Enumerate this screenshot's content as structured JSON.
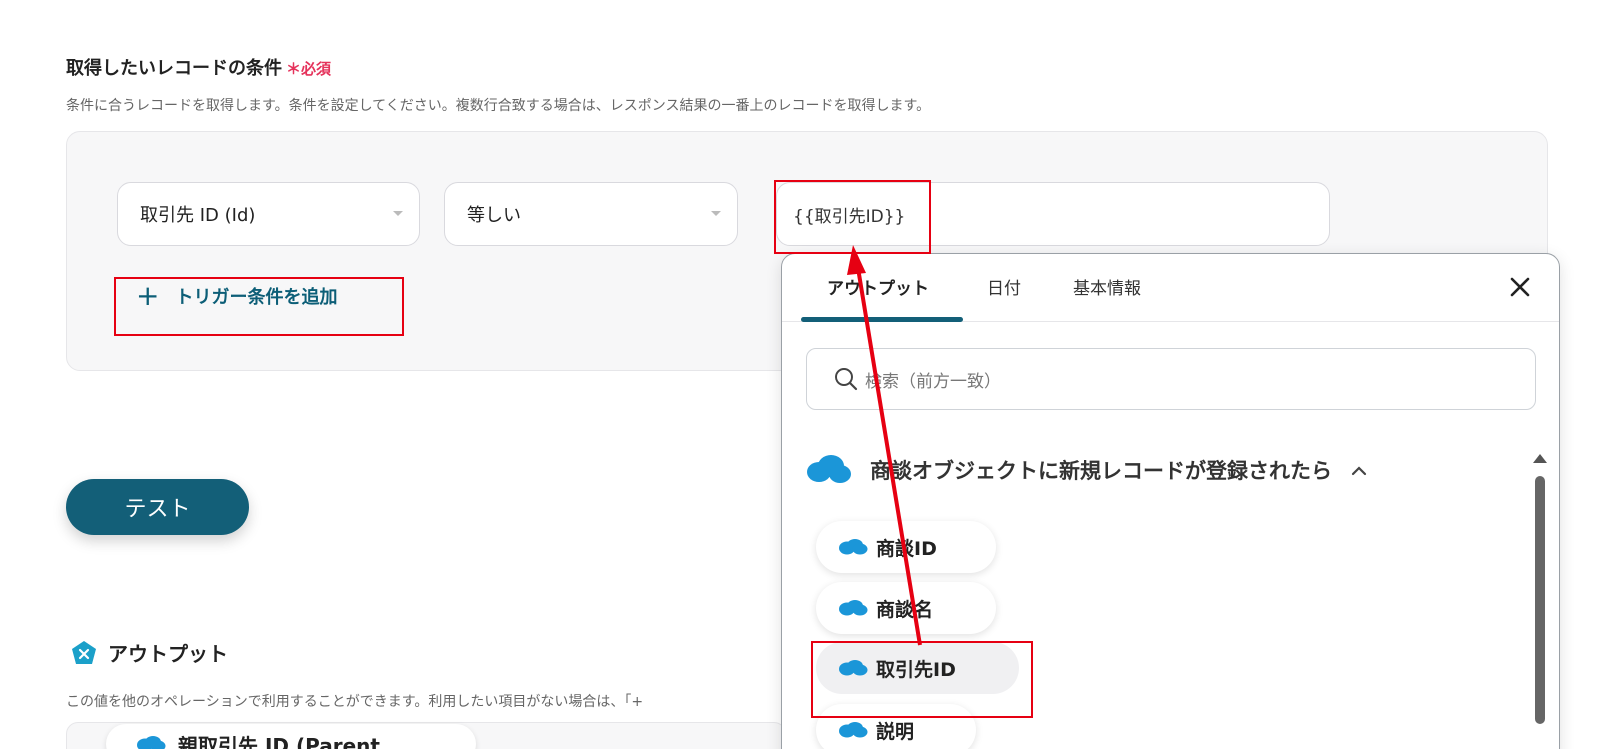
{
  "header": {
    "title": "取得したいレコードの条件",
    "required_mark": "＊必須",
    "description": "条件に合うレコードを取得します。条件を設定してください。複数行合致する場合は、レスポンス結果の一番上のレコードを取得します。"
  },
  "condition": {
    "field_select": "取引先 ID (Id)",
    "operator_select": "等しい",
    "value": "{{取引先ID}}",
    "add_trigger_label": "トリガー条件を追加"
  },
  "test_button": "テスト",
  "output": {
    "title": "アウトプット",
    "description": "この値を他のオペレーションで利用することができます。利用したい項目がない場合は、「+",
    "first_item": "親取引先 ID (Parent…"
  },
  "popup": {
    "tabs": [
      "アウトプット",
      "日付",
      "基本情報"
    ],
    "active_tab": 0,
    "search_placeholder": "検索（前方一致）",
    "group_title": "商談オブジェクトに新規レコードが登録されたら",
    "items": [
      "商談ID",
      "商談名",
      "取引先ID",
      "説明"
    ],
    "selected_item": "取引先ID"
  },
  "colors": {
    "accent": "#135f78",
    "required": "#e5325b",
    "highlight": "#e60012",
    "salesforce": "#1b96d8"
  },
  "icons": [
    "search-icon",
    "close-icon",
    "salesforce-cloud-icon",
    "chevron-up-icon",
    "plus-icon",
    "output-pentagon-icon"
  ]
}
